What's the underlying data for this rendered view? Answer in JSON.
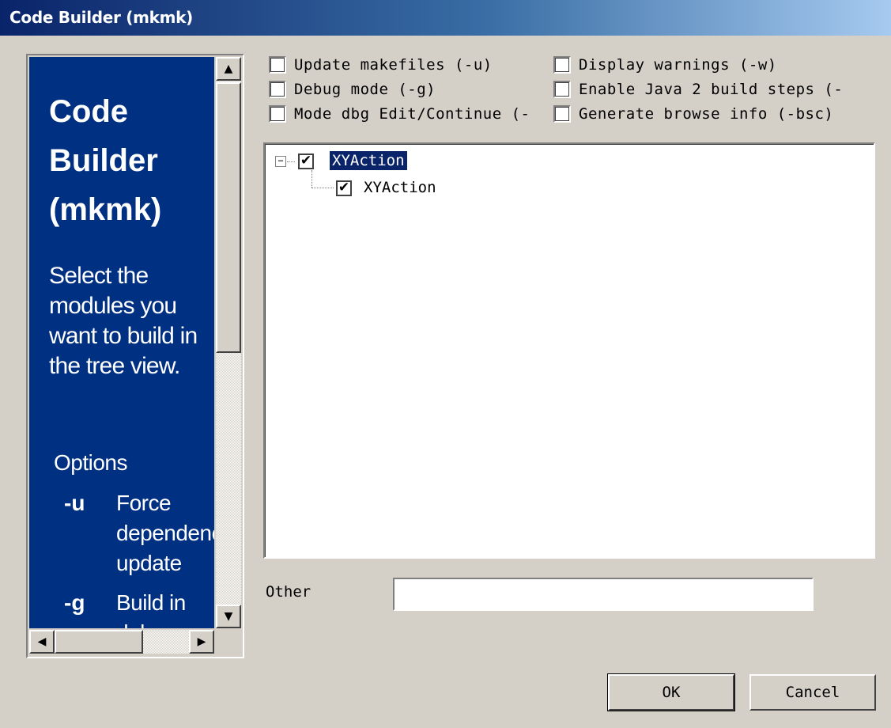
{
  "window": {
    "title": "Code Builder (mkmk)"
  },
  "help": {
    "heading": "Code Builder (mkmk)",
    "description": "Select the modules you want to build in the tree view.",
    "options_title": "Options",
    "options": [
      {
        "flag": "-u",
        "text": "Force dependencies update"
      },
      {
        "flag": "-g",
        "text": "Build in debug mode (no"
      }
    ]
  },
  "options_checkboxes": [
    {
      "label": "Update makefiles (-u)",
      "checked": false
    },
    {
      "label": "Display warnings (-w)",
      "checked": false
    },
    {
      "label": "Debug mode (-g)",
      "checked": false
    },
    {
      "label": "Enable Java 2 build steps (-",
      "checked": false
    },
    {
      "label": "Mode dbg Edit/Continue (-",
      "checked": false
    },
    {
      "label": "Generate browse info (-bsc)",
      "checked": false
    }
  ],
  "tree": {
    "root": {
      "label": "XYAction",
      "checked": true,
      "expanded": true,
      "selected": true
    },
    "children": [
      {
        "label": "XYAction",
        "checked": true
      }
    ]
  },
  "other": {
    "label": "Other",
    "value": ""
  },
  "buttons": {
    "ok": "OK",
    "cancel": "Cancel"
  },
  "icons": {
    "scroll_up": "▲",
    "scroll_down": "▼",
    "scroll_left": "◀",
    "scroll_right": "▶",
    "check": "✔",
    "collapse": "−"
  }
}
